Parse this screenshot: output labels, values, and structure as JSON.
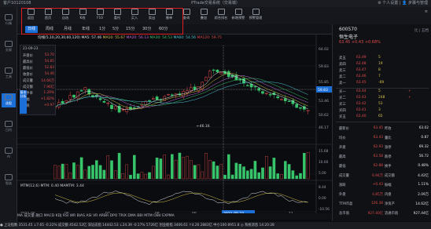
{
  "titlebar": {
    "account": "客户10120108",
    "title": "PTrade交易系统（交易端）",
    "right": "⚙ 个人设置 | 👤 步骤与管理"
  },
  "leftbar": [
    {
      "label": "行情",
      "active": false
    },
    {
      "label": "交易",
      "active": false
    },
    {
      "label": "工具",
      "active": false
    },
    {
      "label": "选股",
      "active": true
    },
    {
      "label": "日内",
      "active": false
    },
    {
      "label": "AI",
      "active": false
    },
    {
      "label": "智选",
      "active": false
    }
  ],
  "toolbar": [
    "返回",
    "首页",
    "自选",
    "K线",
    "F10",
    "委托",
    "买入",
    "卖出",
    "撤单",
    "查询",
    "叠加",
    "综合排名",
    "新增预警",
    "预警管理"
  ],
  "toolbar_right": "≡",
  "periods": [
    "日线",
    "周线",
    "月线",
    "年线",
    "1分",
    "5分",
    "15分",
    "30分",
    "60分"
  ],
  "active_period": "日线",
  "ma": {
    "label": "均线(5,10,20,30,60,120)",
    "ma5": "MA5: 57.46",
    "ma10": "MA10: 55.67",
    "ma20": "MA20: 56.13",
    "ma30": "MA30: 54.53",
    "ma60": "MA60: 54.56",
    "ma120": "MA120: 59.75"
  },
  "infobox": {
    "date": "21-09-23",
    "rows": [
      [
        "开盘价",
        "53.70"
      ],
      [
        "最高价",
        "54.85"
      ],
      [
        "最低价",
        "52.83"
      ],
      [
        "收盘价",
        "54.46"
      ],
      [
        "成交量",
        "14.66万"
      ],
      [
        "成交额",
        "7.96亿"
      ],
      [
        "换手率",
        "1.29%"
      ],
      [
        "涨幅",
        "+1.82%"
      ],
      [
        "涨跌",
        "+0.97"
      ]
    ],
    "tab": "基本分析"
  },
  "chart_data": {
    "type": "candlestick",
    "ylabels": [
      "64.02",
      "59.83",
      "55.85",
      "53.46",
      "50.62",
      "46.17"
    ],
    "price_label": "59.83",
    "low_label": "46.16",
    "high_label": "64.02",
    "xlabels": [
      "2021-05",
      "06",
      "07",
      "08",
      "09",
      "2021-09-23",
      "11"
    ],
    "volume_labels": [
      "15.68",
      "10.00",
      "5.00"
    ],
    "mtm": {
      "label": "MTM(12,6)",
      "mtm": "MTM: 0.40",
      "mamtm": "MAMTM: 3.44",
      "ticks": [
        "8.44",
        "0.00",
        "-10.56"
      ]
    }
  },
  "bottom_fns": "MA  成交量  融口  MACD  KDJ  RSI  WR  BIAS  ASI  VR  ARBR  DPO  TRIX  DMA  BBI  MTM  OBV  EXPMA",
  "right_panel": {
    "code": "600570",
    "name": "恒生电子",
    "price": "63.45",
    "change": "+0.43",
    "pct": "+0.68%",
    "tabs": "比 | 五档",
    "asks": [
      [
        "卖五",
        "63.49",
        "5",
        ""
      ],
      [
        "卖四",
        "63.48",
        "19",
        ""
      ],
      [
        "卖三",
        "63.47",
        "8",
        ""
      ],
      [
        "卖二",
        "63.46",
        "7",
        ""
      ],
      [
        "卖一",
        "63.45",
        "-69",
        ""
      ]
    ],
    "bids": [
      [
        "买一",
        "63.44",
        "5",
        "+"
      ],
      [
        "买二",
        "63.43",
        "248",
        "+"
      ],
      [
        "买三",
        "63.42",
        "53",
        ""
      ],
      [
        "买四",
        "63.41",
        "3",
        ""
      ],
      [
        "买五",
        "63.40",
        "65",
        ""
      ]
    ],
    "stats_left": [
      [
        "最新价",
        "63.45"
      ],
      [
        "均价",
        "63.43"
      ],
      [
        "开盘",
        "62.93"
      ],
      [
        "最高",
        "63.58"
      ],
      [
        "最低",
        "62.88"
      ],
      [
        "成交量",
        "6.94万"
      ],
      [
        "涨跌",
        "+0.43"
      ],
      [
        "外盘",
        "4.85万"
      ],
      [
        "TTM市盈",
        "126.38"
      ],
      [
        "总市值",
        "927.40亿"
      ]
    ],
    "stats_right": [
      [
        "昨收",
        "63.02"
      ],
      [
        "量比",
        "0.87"
      ],
      [
        "涨停",
        "69.32"
      ],
      [
        "跌停",
        "56.72"
      ],
      [
        "换手",
        "0.48%"
      ],
      [
        "成交额",
        "4.42亿"
      ],
      [
        "振幅",
        "1.11%"
      ],
      [
        "内盘",
        "2.09万"
      ],
      [
        "净资产",
        "14.62亿"
      ],
      [
        "流通市值",
        "927.44亿"
      ]
    ]
  },
  "statusbar": "● 上证指数 3531.45 ↓7.65  -0.22%  成交额 4542.52亿   深证成指 14442.53 ↓24.39  -0.17%  5726亿   创业板指 3406.61 ↑4.26  2883亿   中小100 8951.8   ◎ 系统消息   14:20:28"
}
